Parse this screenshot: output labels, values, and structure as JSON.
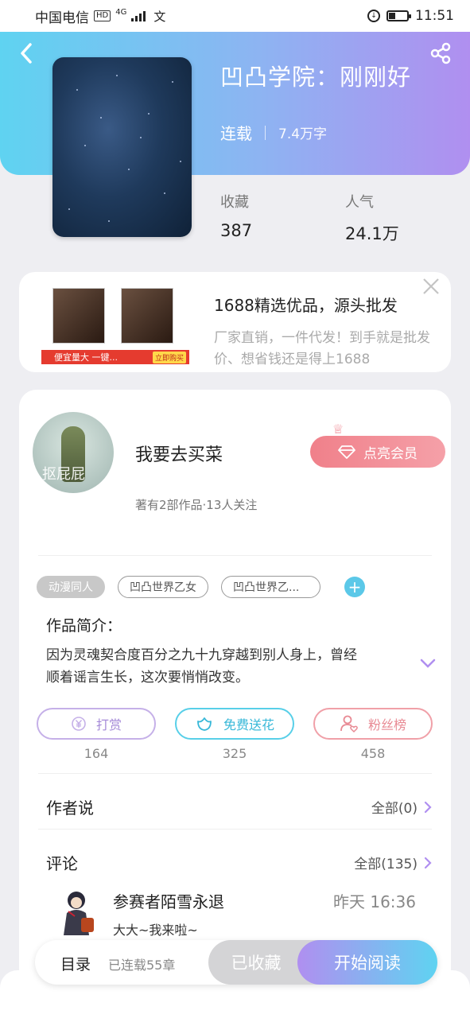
{
  "status_bar": {
    "carrier": "中国电信",
    "hd": "HD",
    "network": "4G",
    "extra_icon": "文",
    "time": "11:51"
  },
  "book": {
    "title": "凹凸学院：刚刚好",
    "status": "连载",
    "word_count": "7.4万字",
    "stats": [
      {
        "label": "收藏",
        "value": "387"
      },
      {
        "label": "人气",
        "value": "24.1万"
      }
    ]
  },
  "ad": {
    "title": "1688精选优品，源头批发",
    "description_line1": "厂家直销，一件代发！到手就是批发",
    "description_line2": "价、想省钱还是得上1688",
    "banner_text": "便宜量大 一键...",
    "banner_button": "立即购买"
  },
  "author": {
    "name": "我要去买菜",
    "avatar_watermark": "抠屁屁",
    "subtitle": "著有2部作品·13人关注",
    "vip_button": "点亮会员"
  },
  "tags": [
    "动漫同人",
    "凹凸世界乙女",
    "凹凸世界乙..."
  ],
  "intro": {
    "label": "作品简介：",
    "text_line1": "因为灵魂契合度百分之九十九穿越到别人身上，曾经",
    "text_line2": "顺着谣言生长，这次要悄悄改变。"
  },
  "actions": [
    {
      "label": "打赏",
      "count": "164"
    },
    {
      "label": "免费送花",
      "count": "325"
    },
    {
      "label": "粉丝榜",
      "count": "458"
    }
  ],
  "author_says": {
    "title": "作者说",
    "link": "全部(0)"
  },
  "comments": {
    "title": "评论",
    "link": "全部(135)",
    "items": [
      {
        "user": "参赛者陌雪永退",
        "time": "昨天 16:36",
        "text": "大大~我来啦~"
      }
    ]
  },
  "bottom_bar": {
    "toc_label": "目录",
    "toc_sub": "已连载55章",
    "collected_label": "已收藏",
    "read_label": "开始阅读"
  }
}
